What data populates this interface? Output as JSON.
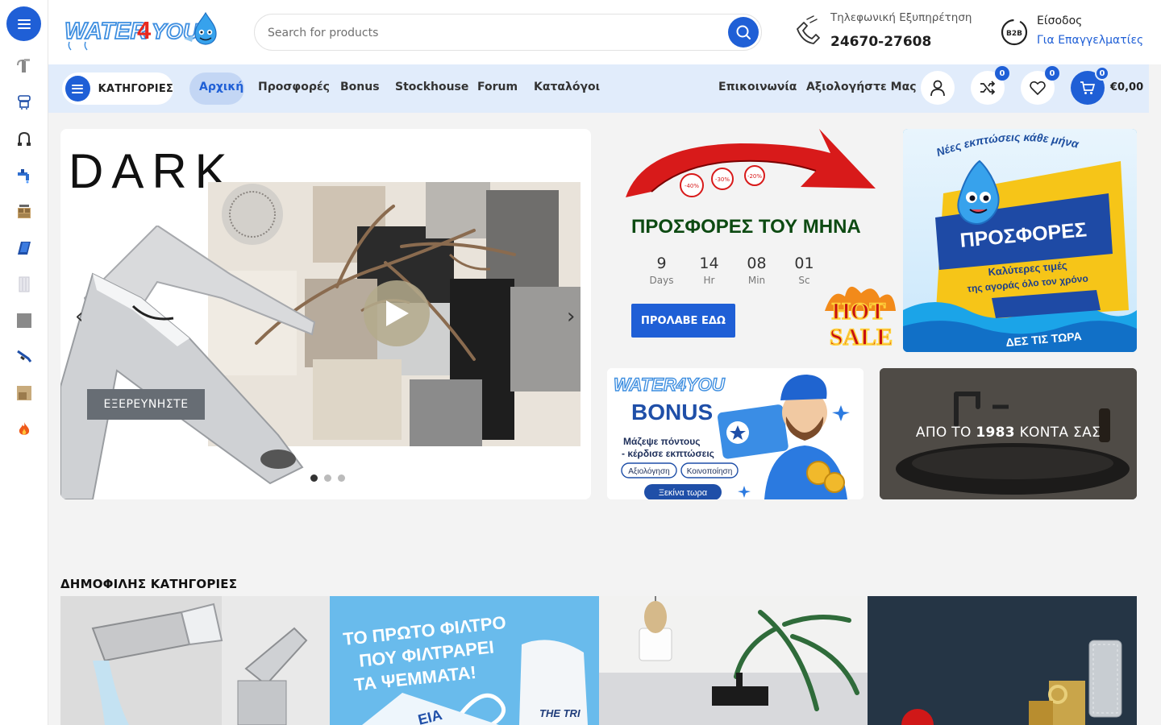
{
  "brand": {
    "logo_text": "WATER4YOU"
  },
  "rail": {
    "icons": [
      "menu-icon",
      "faucet-icon",
      "shower-icon",
      "siphon-icon",
      "tap-icon",
      "cabinet-icon",
      "tile-icon",
      "radiator-icon",
      "stone-icon",
      "pipe-icon",
      "wood-icon",
      "fire-icon"
    ]
  },
  "header": {
    "search_placeholder": "Search for products",
    "support_label": "Τηλεφωνική Εξυπηρέτηση",
    "support_phone": "24670-27608",
    "login_label": "Είσοδος",
    "pro_link": "Για Επαγγελματίες",
    "b2b_badge": "B2B"
  },
  "nav": {
    "categories_label": "ΚΑΤΗΓΟΡΙΕΣ",
    "items": [
      "Αρχική",
      "Προσφορές",
      "Bonus",
      "Stockhouse",
      "Forum",
      "Καταλόγοι"
    ],
    "right_items": [
      "Επικοινωνία",
      "Αξιολογήστε Μας"
    ],
    "compare_count": "0",
    "wishlist_count": "0",
    "cart_count": "0",
    "cart_total": "€0,00"
  },
  "hero": {
    "title": "DARK",
    "explore_label": "ΕΞΕΡΕΥΝΗΣΤΕ",
    "prev": "‹",
    "next": "›",
    "slides": 3,
    "active_slide": 1
  },
  "promo": {
    "title": "ΠΡΟΣΦΟΡΕΣ ΤΟΥ ΜΗΝΑ",
    "tags": [
      "-40%",
      "-30%",
      "-20%"
    ],
    "countdown": [
      {
        "value": "9",
        "unit": "Days"
      },
      {
        "value": "14",
        "unit": "Hr"
      },
      {
        "value": "08",
        "unit": "Min"
      },
      {
        "value": "01",
        "unit": "Sc"
      }
    ],
    "cta": "ΠΡΟΛΑΒΕ ΕΔΩ",
    "hot_sale": [
      "HOT",
      "SALE"
    ]
  },
  "offers_banner": {
    "tagline": "Νέες εκπτώσεις κάθε μήνα",
    "title": "ΠΡΟΣΦΟΡΕΣ",
    "subtitle_1": "Καλύτερες τιμές",
    "subtitle_2": "της αγοράς όλο τον χρόνο",
    "cta": "ΔΕΣ ΤΙΣ ΤΩΡΑ"
  },
  "bonus_banner": {
    "logo": "WATER4YOU",
    "title": "BONUS",
    "line_1": "Μάζεψε πόντους",
    "line_2": "- κέρδισε εκπτώσεις",
    "pill_1": "Αξιολόγηση",
    "pill_2": "Κοινοποίηση",
    "cta": "Ξεκίνα τωρα"
  },
  "since_banner": {
    "text_a": "ΑΠΟ ΤΟ ",
    "text_b": "1983",
    "text_c": " ΚΟΝΤΑ ΣΑΣ"
  },
  "categories": {
    "heading": "ΔΗΜΟΦΙΛΗΣ ΚΑΤΗΓΟΡΙΕΣ",
    "filter_tile": {
      "line_1": "ΤΟ ΠΡΩΤΟ ΦΙΛΤΡΟ",
      "line_2": "ΠΟΥ ΦΙΛΤΡΑΡΕΙ",
      "line_3": "ΤΑ ΨΕΜΜΑΤΑ!",
      "label_a": "ΕΙΑ",
      "label_b": "THE TRI"
    }
  },
  "colors": {
    "accent": "#1f5fd6",
    "nav_bg": "#e1ecfb",
    "promo_green": "#0d4a12"
  }
}
